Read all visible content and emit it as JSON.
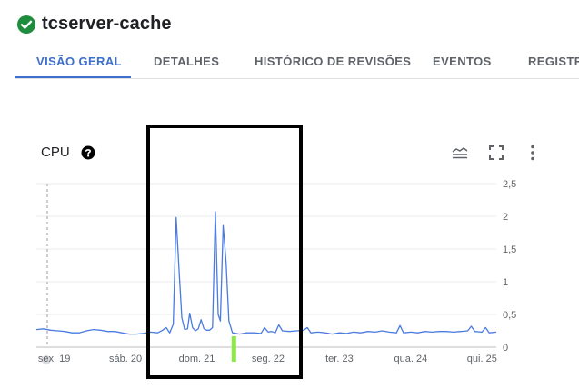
{
  "service": {
    "name": "tcserver-cache",
    "status_icon": "check-circle-icon",
    "status_color": "#1e8e3e"
  },
  "tabs": [
    {
      "label": "VISÃO GERAL",
      "active": true
    },
    {
      "label": "DETALHES",
      "active": false
    },
    {
      "label": "HISTÓRICO DE REVISÕES",
      "active": false
    },
    {
      "label": "EVENTOS",
      "active": false
    },
    {
      "label": "REGISTRO",
      "active": false
    }
  ],
  "accent_color": "#3c6fce",
  "card": {
    "title": "CPU",
    "icons": [
      "help-icon",
      "legend-toggle-icon",
      "fullscreen-icon",
      "more-vert-icon"
    ]
  },
  "chart_data": {
    "type": "line",
    "title": "CPU",
    "xlabel": "",
    "ylabel": "",
    "ylim": [
      0,
      2.5
    ],
    "y_ticks": [
      "0",
      "0,5",
      "1",
      "1,5",
      "2",
      "2,5"
    ],
    "x_ticks": [
      "sex. 19",
      "sáb. 20",
      "dom. 21",
      "seg. 22",
      "ter. 23",
      "qua. 24",
      "qui. 25"
    ],
    "x_range_days": [
      18.85,
      25.3
    ],
    "grid": true,
    "series": [
      {
        "color": "#4a7be0",
        "points": [
          [
            18.85,
            0.27
          ],
          [
            18.95,
            0.28
          ],
          [
            19.05,
            0.26
          ],
          [
            19.15,
            0.25
          ],
          [
            19.25,
            0.24
          ],
          [
            19.35,
            0.22
          ],
          [
            19.45,
            0.22
          ],
          [
            19.55,
            0.25
          ],
          [
            19.65,
            0.27
          ],
          [
            19.75,
            0.26
          ],
          [
            19.85,
            0.24
          ],
          [
            19.95,
            0.24
          ],
          [
            20.05,
            0.22
          ],
          [
            20.15,
            0.2
          ],
          [
            20.25,
            0.2
          ],
          [
            20.35,
            0.21
          ],
          [
            20.45,
            0.23
          ],
          [
            20.55,
            0.22
          ],
          [
            20.62,
            0.26
          ],
          [
            20.67,
            0.3
          ],
          [
            20.72,
            0.22
          ],
          [
            20.77,
            0.35
          ],
          [
            20.81,
            1.98
          ],
          [
            20.85,
            1.2
          ],
          [
            20.89,
            0.45
          ],
          [
            20.93,
            0.27
          ],
          [
            20.97,
            0.28
          ],
          [
            21.0,
            0.52
          ],
          [
            21.04,
            0.3
          ],
          [
            21.08,
            0.25
          ],
          [
            21.12,
            0.28
          ],
          [
            21.16,
            0.42
          ],
          [
            21.2,
            0.28
          ],
          [
            21.24,
            0.26
          ],
          [
            21.28,
            0.26
          ],
          [
            21.32,
            0.3
          ],
          [
            21.36,
            2.07
          ],
          [
            21.4,
            0.5
          ],
          [
            21.43,
            0.4
          ],
          [
            21.47,
            1.86
          ],
          [
            21.51,
            1.3
          ],
          [
            21.55,
            0.4
          ],
          [
            21.6,
            0.22
          ],
          [
            21.7,
            0.2
          ],
          [
            21.8,
            0.22
          ],
          [
            21.9,
            0.22
          ],
          [
            22.0,
            0.21
          ],
          [
            22.05,
            0.3
          ],
          [
            22.1,
            0.23
          ],
          [
            22.15,
            0.24
          ],
          [
            22.2,
            0.22
          ],
          [
            22.25,
            0.34
          ],
          [
            22.3,
            0.25
          ],
          [
            22.4,
            0.24
          ],
          [
            22.5,
            0.25
          ],
          [
            22.6,
            0.26
          ],
          [
            22.65,
            0.3
          ],
          [
            22.7,
            0.22
          ],
          [
            22.8,
            0.23
          ],
          [
            22.9,
            0.22
          ],
          [
            23.0,
            0.2
          ],
          [
            23.1,
            0.22
          ],
          [
            23.2,
            0.21
          ],
          [
            23.3,
            0.23
          ],
          [
            23.4,
            0.22
          ],
          [
            23.5,
            0.24
          ],
          [
            23.6,
            0.23
          ],
          [
            23.7,
            0.25
          ],
          [
            23.8,
            0.23
          ],
          [
            23.9,
            0.22
          ],
          [
            23.95,
            0.33
          ],
          [
            24.0,
            0.22
          ],
          [
            24.1,
            0.23
          ],
          [
            24.2,
            0.22
          ],
          [
            24.3,
            0.24
          ],
          [
            24.4,
            0.23
          ],
          [
            24.5,
            0.24
          ],
          [
            24.6,
            0.24
          ],
          [
            24.7,
            0.23
          ],
          [
            24.8,
            0.24
          ],
          [
            24.9,
            0.25
          ],
          [
            24.95,
            0.32
          ],
          [
            25.0,
            0.24
          ],
          [
            25.1,
            0.23
          ],
          [
            25.15,
            0.3
          ],
          [
            25.2,
            0.22
          ],
          [
            25.3,
            0.23
          ]
        ]
      }
    ],
    "marker": {
      "x": 21.62,
      "color": "#8de84a"
    }
  }
}
